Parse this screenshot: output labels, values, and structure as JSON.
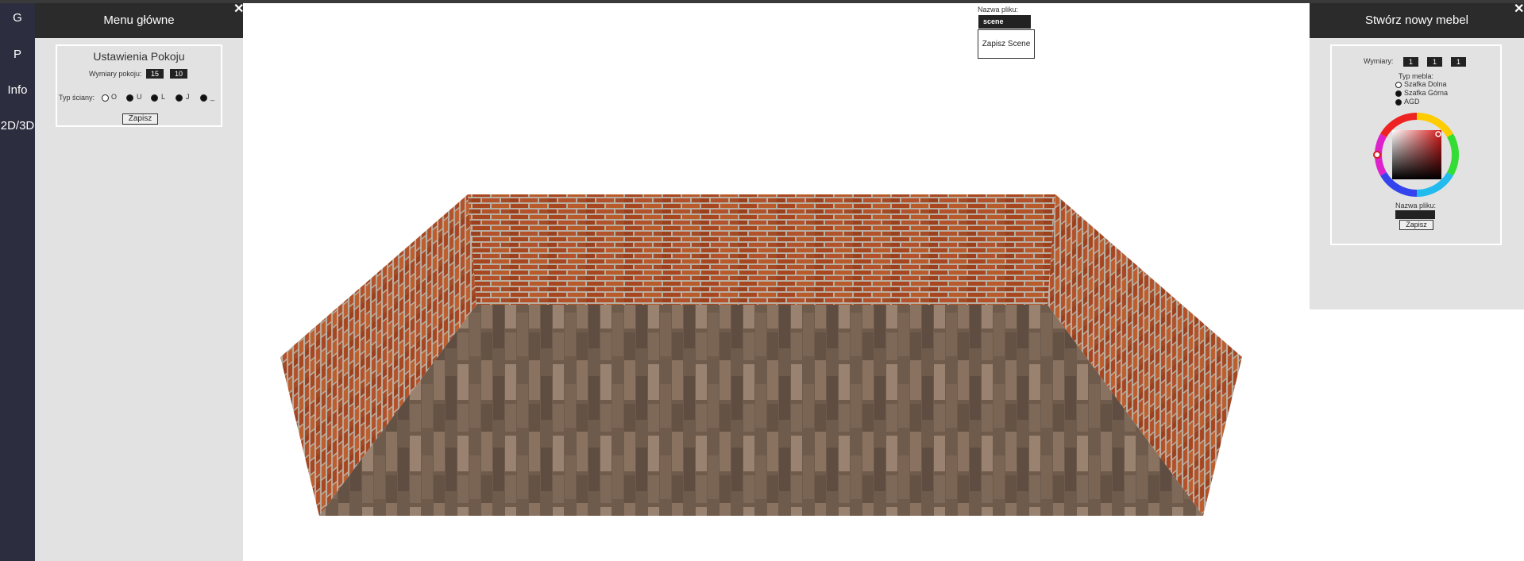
{
  "rail": {
    "items": [
      "G",
      "P",
      "Info",
      "2D/3D"
    ]
  },
  "left_panel": {
    "title": "Menu główne",
    "close": "✕",
    "room_settings": {
      "title": "Ustawienia Pokoju",
      "dims_label": "Wymiary pokoju:",
      "width": "15",
      "length": "10",
      "wall_type_label": "Typ ściany:",
      "wall_types": [
        "O",
        "U",
        "L",
        "J",
        "_"
      ],
      "selected_wall_type": "O",
      "save": "Zapisz"
    }
  },
  "scene": {
    "file_name_label": "Nazwa pliku:",
    "file_name_value": "scene",
    "save_scene": "Zapisz Scene"
  },
  "right_panel": {
    "title": "Stwórz nowy mebel",
    "close": "✕",
    "dims_label": "Wymiary:",
    "dims": [
      "1",
      "1",
      "1"
    ],
    "type_label": "Typ mebla:",
    "types": [
      "Szafka Dolna",
      "Szafka Górna",
      "AGD"
    ],
    "selected_type": "Szafka Dolna",
    "file_name_label": "Nazwa pliku:",
    "file_name_value": "",
    "save": "Zapisz"
  },
  "colors": {
    "rail": "#2c2d3e",
    "header": "#2b2b2b",
    "panel": "#e2e2e2",
    "brick": "#a84a22",
    "floor": "#6e5a4a"
  }
}
